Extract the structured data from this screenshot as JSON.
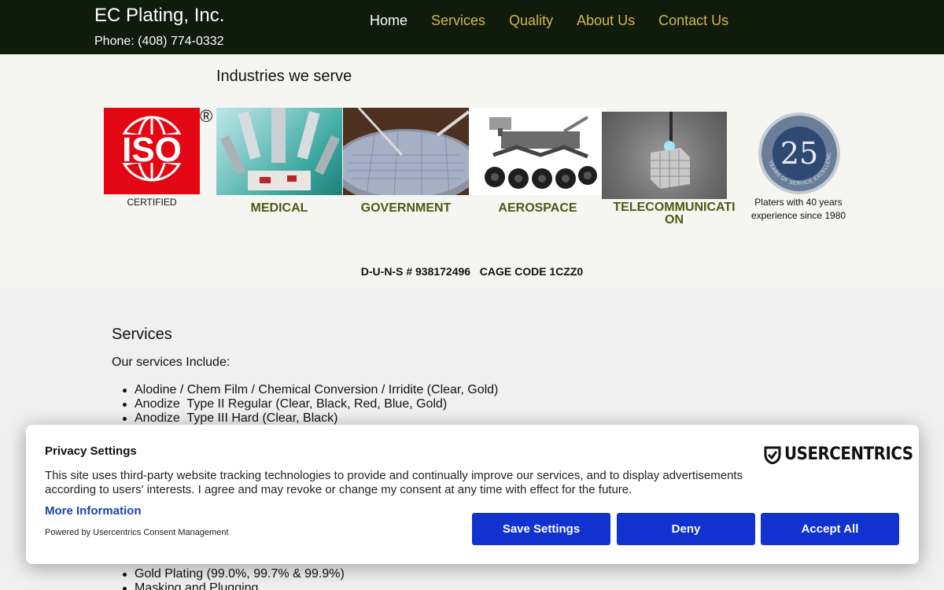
{
  "header": {
    "brand": "EC Plating, Inc.",
    "phone": "Phone: (408) 774-0332",
    "nav": [
      {
        "label": "Home",
        "active": true
      },
      {
        "label": "Services"
      },
      {
        "label": "Quality"
      },
      {
        "label": "About Us"
      },
      {
        "label": "Contact Us"
      }
    ]
  },
  "industries": {
    "title": "Industries we serve",
    "iso": {
      "mark": "ISO",
      "reg": "®",
      "caption": "CERTIFIED"
    },
    "items": [
      {
        "label": "MEDICAL"
      },
      {
        "label": "GOVERNMENT"
      },
      {
        "label": "AEROSPACE"
      },
      {
        "label": "TELECOMMUNICATI ON"
      }
    ],
    "badge": {
      "number": "25",
      "ring_text": "YEARS OF SERVICE EXCELLENCE",
      "caption": "Platers with 40 years experience since 1980"
    },
    "duns": "D-U-N-S # 938172496   CAGE CODE 1CZZ0"
  },
  "services": {
    "title": "Services",
    "intro": "Our services Include:",
    "items": [
      "Alodine / Chem Film / Chemical Conversion / Irridite (Clear, Gold)",
      "Anodize  Type II Regular (Clear, Black, Red, Blue, Gold)",
      "Anodize  Type III Hard (Clear, Black)"
    ],
    "items_below": [
      "Gold Plating (99.0%, 99.7% & 99.9%)",
      "Masking and Plugging"
    ]
  },
  "consent": {
    "title": "Privacy Settings",
    "text": "This site uses third-party website tracking technologies to provide and continually improve our services, and to display advertisements according to users' interests. I agree and may revoke or change my consent at any time with effect for the future.",
    "more": "More Information",
    "powered": "Powered by Usercentrics Consent Management",
    "logo": "USERCENTRICS",
    "buttons": {
      "save": "Save Settings",
      "deny": "Deny",
      "accept": "Accept All"
    },
    "button_color": "#1132cf"
  },
  "colors": {
    "header_bg": "#0f1b0b",
    "nav_link": "#d7b553",
    "label_olive": "#4d5a0f",
    "iso_red": "#e30613"
  }
}
